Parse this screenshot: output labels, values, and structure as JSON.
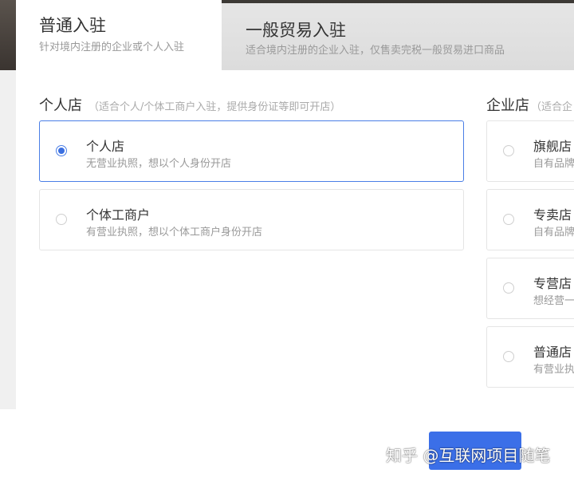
{
  "tabs": {
    "normal": {
      "title": "普通入驻",
      "subtitle": "针对境内注册的企业或个人入驻"
    },
    "general_trade": {
      "title": "一般贸易入驻",
      "subtitle": "适合境内注册的企业入驻，仅售卖完税一般贸易进口商品"
    }
  },
  "personal": {
    "title": "个人店",
    "hint": "（适合个人/个体工商户入驻，提供身份证等即可开店）",
    "options": [
      {
        "title": "个人店",
        "desc": "无营业执照，想以个人身份开店",
        "selected": true
      },
      {
        "title": "个体工商户",
        "desc": "有营业执照，想以个体工商户身份开店",
        "selected": false
      }
    ]
  },
  "enterprise": {
    "title": "企业店",
    "hint": "（适合企",
    "options": [
      {
        "title": "旗舰店",
        "desc": "自有品牌"
      },
      {
        "title": "专卖店",
        "desc": "自有品牌"
      },
      {
        "title": "专营店",
        "desc": "想经营一"
      },
      {
        "title": "普通店",
        "desc": "有营业执"
      }
    ]
  },
  "watermark": "知乎 @互联网项目随笔",
  "colors": {
    "accent": "#3b6fe8",
    "selected_border": "#4a7ee6"
  }
}
